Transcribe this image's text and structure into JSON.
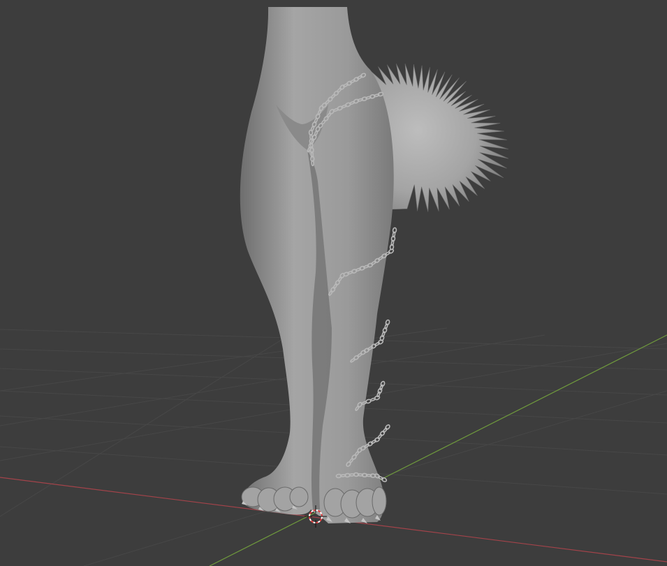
{
  "app": {
    "view": "3D Viewport",
    "shading": "solid"
  },
  "colors": {
    "background": "#3d3d3d",
    "grid_line": "#474747",
    "x_axis": "#a3434a",
    "y_axis": "#6f9a3d",
    "mesh_base": "#9e9e9e",
    "mesh_shadow": "#6e6e6e",
    "mesh_highlight": "#b4b4b4",
    "chain": "#b8b8b8",
    "fur": "#a9a9a9",
    "cursor_red": "#e04040",
    "cursor_white": "#ffffff"
  },
  "scene": {
    "objects": [
      {
        "id": "body",
        "type": "mesh"
      },
      {
        "id": "tail",
        "type": "mesh"
      },
      {
        "id": "chain",
        "type": "mesh"
      }
    ],
    "cursor": {
      "icon": "3d-cursor-icon"
    }
  }
}
